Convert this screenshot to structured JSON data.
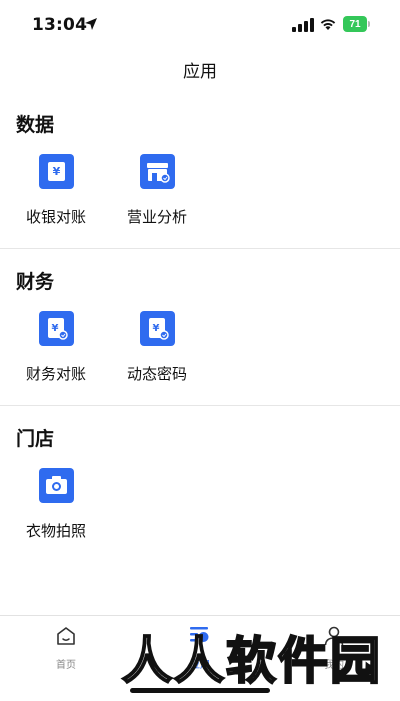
{
  "status": {
    "time": "13:04",
    "battery": "71"
  },
  "header": {
    "title": "应用"
  },
  "sections": [
    {
      "title": "数据",
      "items": [
        {
          "label": "收银对账",
          "icon": "cashier-icon"
        },
        {
          "label": "营业分析",
          "icon": "store-analysis-icon"
        }
      ]
    },
    {
      "title": "财务",
      "items": [
        {
          "label": "财务对账",
          "icon": "finance-reconcile-icon"
        },
        {
          "label": "动态密码",
          "icon": "dynamic-password-icon"
        }
      ]
    },
    {
      "title": "门店",
      "items": [
        {
          "label": "衣物拍照",
          "icon": "camera-icon"
        }
      ]
    }
  ],
  "tabbar": [
    {
      "label": "首页",
      "icon": "home-icon",
      "active": false
    },
    {
      "label": "应用",
      "icon": "apps-icon",
      "active": true
    },
    {
      "label": "我的",
      "icon": "user-icon",
      "active": false
    }
  ],
  "watermark": "人人软件园",
  "colors": {
    "accent": "#2f6bef",
    "battery": "#34c759"
  }
}
